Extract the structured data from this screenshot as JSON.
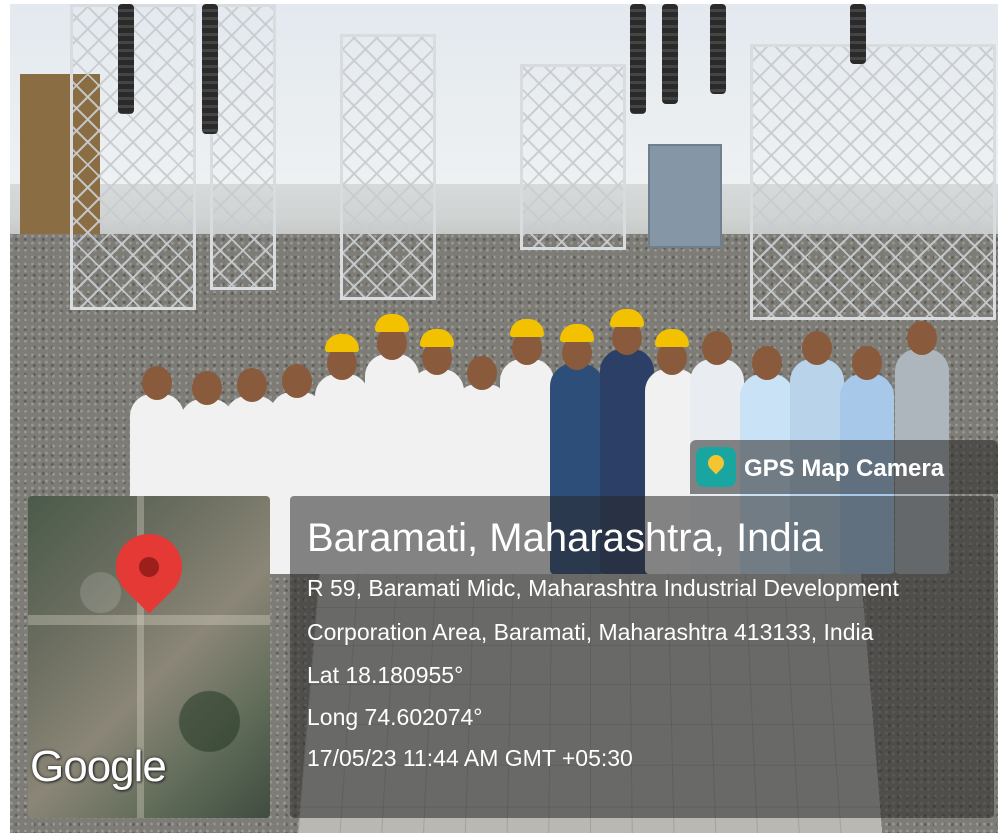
{
  "photo": {
    "description_icons": [
      "substation-towers",
      "group-of-people"
    ]
  },
  "map": {
    "pin_icon": "map-pin-icon",
    "pin_color": "#e53935",
    "watermark": "Google"
  },
  "badge": {
    "icon": "gps-map-camera-icon",
    "label": "GPS Map Camera"
  },
  "location": {
    "city": "Baramati, Maharashtra, India",
    "address_line1": "R 59, Baramati Midc, Maharashtra Industrial Development",
    "address_line2": "Corporation Area, Baramati, Maharashtra 413133, India",
    "latitude": "Lat 18.180955°",
    "longitude": "Long 74.602074°",
    "timestamp": "17/05/23 11:44 AM GMT +05:30"
  }
}
